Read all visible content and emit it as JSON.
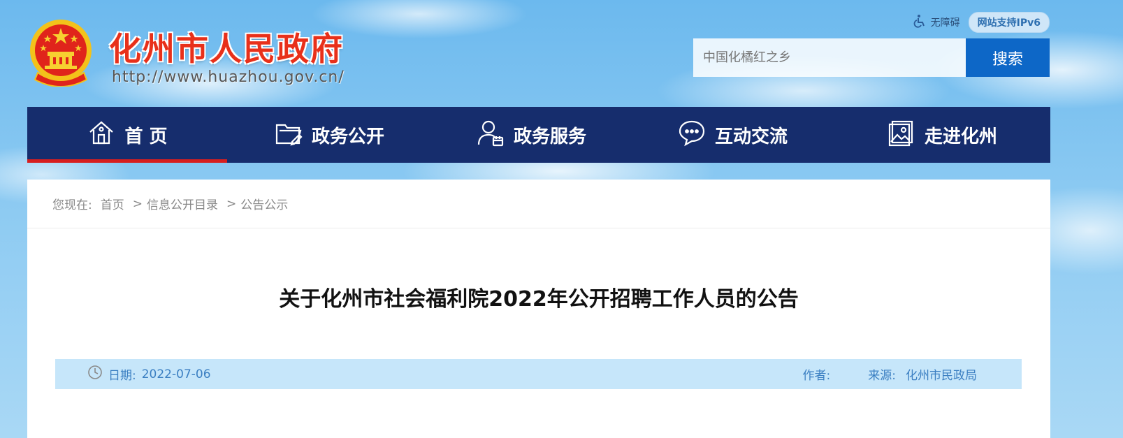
{
  "header": {
    "site_title": "化州市人民政府",
    "site_url": "http://www.huazhou.gov.cn/",
    "accessibility_label": "无障碍",
    "ipv6_label": "网站支持IPv6"
  },
  "search": {
    "placeholder": "中国化橘红之乡",
    "button_label": "搜索"
  },
  "nav": {
    "items": [
      {
        "label": "首 页",
        "icon": "home-icon",
        "active": true
      },
      {
        "label": "政务公开",
        "icon": "folder-edit-icon"
      },
      {
        "label": "政务服务",
        "icon": "user-calendar-icon"
      },
      {
        "label": "互动交流",
        "icon": "chat-bubble-icon"
      },
      {
        "label": "走进化州",
        "icon": "picture-icon"
      }
    ]
  },
  "breadcrumb": {
    "prefix": "您现在:",
    "items": [
      "首页",
      "信息公开目录",
      "公告公示"
    ],
    "separator": ">"
  },
  "article": {
    "title": "关于化州市社会福利院2022年公开招聘工作人员的公告",
    "date_label": "日期:",
    "date_value": "2022-07-06",
    "author_label": "作者:",
    "author_value": "",
    "source_label": "来源:",
    "source_value": "化州市民政局"
  },
  "colors": {
    "nav_bg": "#162d6d",
    "nav_active_underline": "#d71f1f",
    "search_button": "#0d67c7",
    "title_red": "#e8301a",
    "meta_bar_bg": "#c6e6fa",
    "meta_text": "#3b7fc2"
  }
}
